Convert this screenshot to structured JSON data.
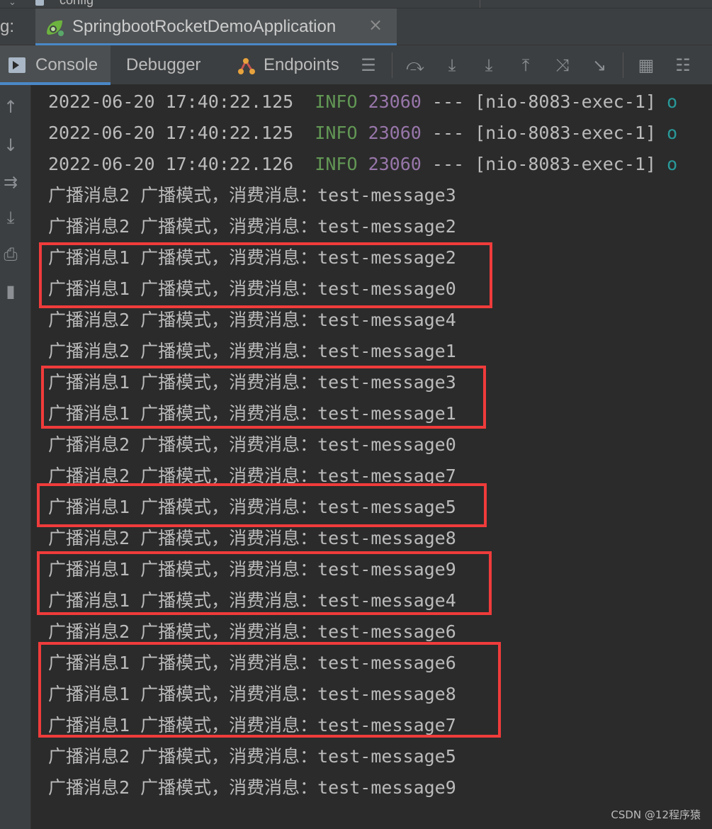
{
  "run_tab_prefix": "g:",
  "run_tab": {
    "title": "SpringbootRocketDemoApplication",
    "close_symbol": "×"
  },
  "config_partial_text": "config",
  "tool_tabs": {
    "console": "Console",
    "debugger": "Debugger",
    "endpoints": "Endpoints"
  },
  "toolbar_icons": [
    "menu-icon",
    "step-over-icon",
    "step-into-icon",
    "force-step-into-icon",
    "step-out-icon",
    "drop-frame-icon",
    "run-to-cursor-icon",
    "evaluate-icon",
    "trace-icon"
  ],
  "left_toolbar_icons": [
    "scroll-up-icon",
    "scroll-down-icon",
    "soft-wrap-icon",
    "scroll-to-end-icon",
    "print-icon",
    "clear-all-icon"
  ],
  "colors": {
    "background": "#2b2b2b",
    "info_level": "#629755",
    "pid": "#9876aa",
    "highlight_box": "#f03b3b",
    "active_tab_underline": "#4a88c7"
  },
  "console": {
    "log_lines": [
      {
        "timestamp": "2022-06-20 17:40:22.125",
        "level": "INFO",
        "pid": "23060",
        "sep": "---",
        "thread": "[nio-8083-exec-1]",
        "tail": "o"
      },
      {
        "timestamp": "2022-06-20 17:40:22.125",
        "level": "INFO",
        "pid": "23060",
        "sep": "---",
        "thread": "[nio-8083-exec-1]",
        "tail": "o"
      },
      {
        "timestamp": "2022-06-20 17:40:22.126",
        "level": "INFO",
        "pid": "23060",
        "sep": "---",
        "thread": "[nio-8083-exec-1]",
        "tail": "o"
      }
    ],
    "message_lines": [
      "广播消息2 广播模式，消费消息：test-message3",
      "广播消息2 广播模式，消费消息：test-message2",
      "广播消息1 广播模式，消费消息：test-message2",
      "广播消息1 广播模式，消费消息：test-message0",
      "广播消息2 广播模式，消费消息：test-message4",
      "广播消息2 广播模式，消费消息：test-message1",
      "广播消息1 广播模式，消费消息：test-message3",
      "广播消息1 广播模式，消费消息：test-message1",
      "广播消息2 广播模式，消费消息：test-message0",
      "广播消息2 广播模式，消费消息：test-message7",
      "广播消息1 广播模式，消费消息：test-message5",
      "广播消息2 广播模式，消费消息：test-message8",
      "广播消息1 广播模式，消费消息：test-message9",
      "广播消息1 广播模式，消费消息：test-message4",
      "广播消息2 广播模式，消费消息：test-message6",
      "广播消息1 广播模式，消费消息：test-message6",
      "广播消息1 广播模式，消费消息：test-message8",
      "广播消息1 广播模式，消费消息：test-message7",
      "广播消息2 广播模式，消费消息：test-message5",
      "广播消息2 广播模式，消费消息：test-message9"
    ]
  },
  "watermark": "CSDN @12程序猿"
}
